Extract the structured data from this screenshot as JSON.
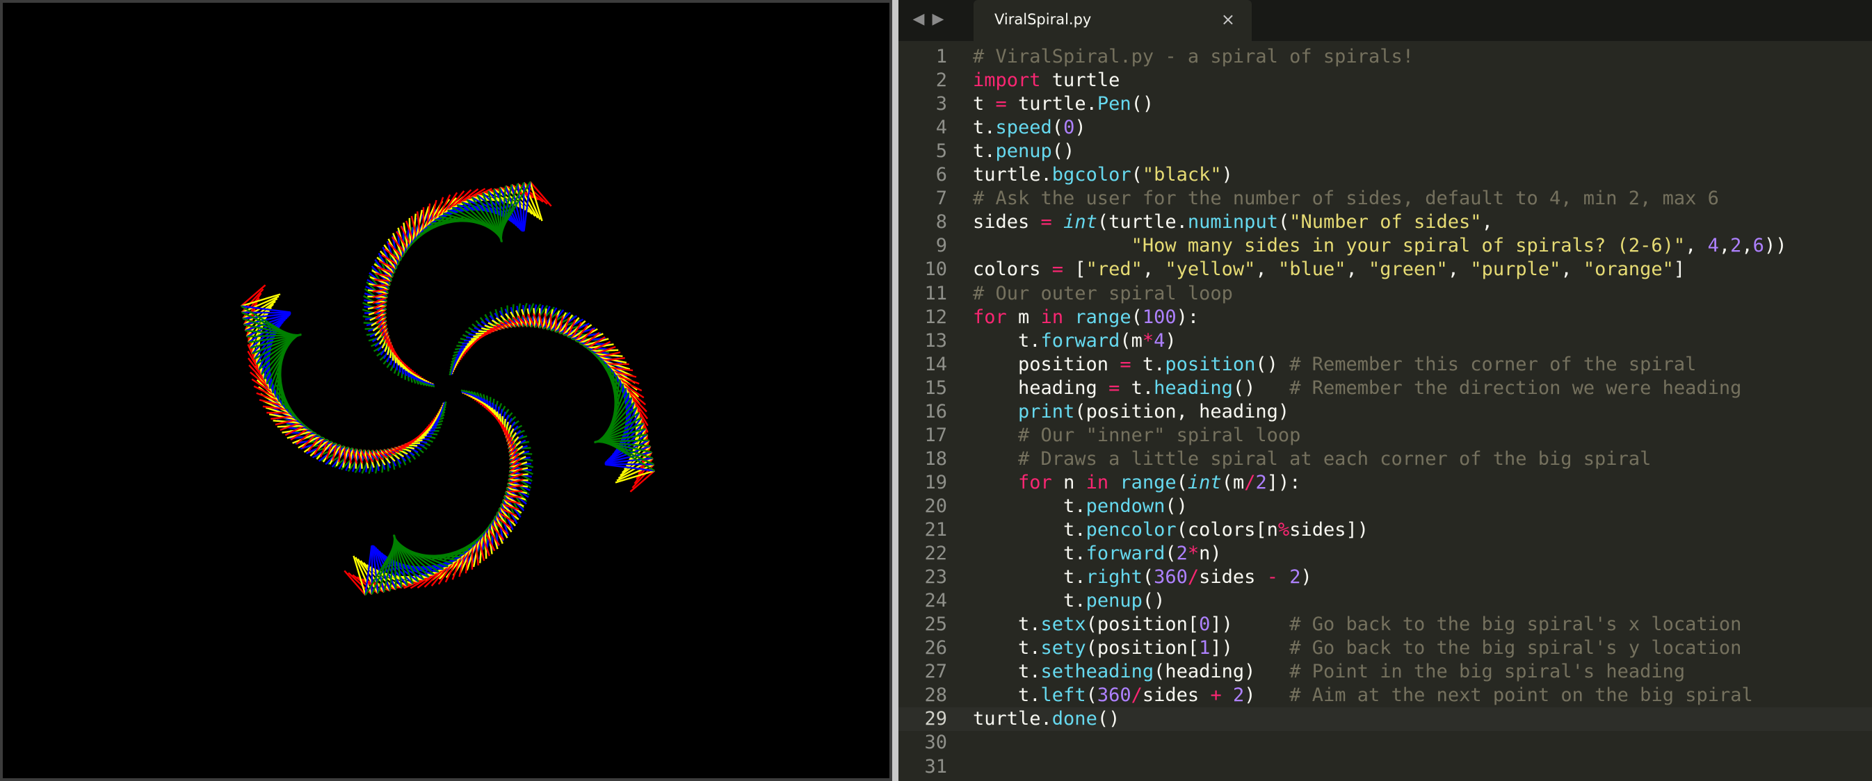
{
  "turtle_window": {
    "background": "#000000",
    "arm_colors": [
      "#ff0000",
      "#ffff00",
      "#0000ff",
      "#008000"
    ]
  },
  "editor": {
    "nav_back_icon": "chevron-left-icon",
    "nav_forward_icon": "chevron-right-icon",
    "back_glyph": "◀",
    "forward_glyph": "▶",
    "tab": {
      "title": "ViralSpiral.py",
      "close_glyph": "×",
      "close_icon": "close-icon"
    },
    "current_line": 29,
    "theme": {
      "background": "#272822",
      "comment": "#75715e",
      "keyword": "#f92672",
      "function": "#66d9ef",
      "string": "#e6db74",
      "number": "#ae81ff",
      "plain": "#f8f8f2"
    },
    "lines": [
      {
        "n": "1",
        "tokens": [
          [
            "comment",
            "# ViralSpiral.py - a spiral of spirals!"
          ]
        ]
      },
      {
        "n": "2",
        "tokens": [
          [
            "keyword",
            "import"
          ],
          [
            "plain",
            " turtle"
          ]
        ]
      },
      {
        "n": "3",
        "tokens": [
          [
            "plain",
            "t "
          ],
          [
            "operator",
            "="
          ],
          [
            "plain",
            " turtle."
          ],
          [
            "func",
            "Pen"
          ],
          [
            "plain",
            "()"
          ]
        ]
      },
      {
        "n": "4",
        "tokens": [
          [
            "plain",
            "t."
          ],
          [
            "func",
            "speed"
          ],
          [
            "plain",
            "("
          ],
          [
            "number",
            "0"
          ],
          [
            "plain",
            ")"
          ]
        ]
      },
      {
        "n": "5",
        "tokens": [
          [
            "plain",
            "t."
          ],
          [
            "func",
            "penup"
          ],
          [
            "plain",
            "()"
          ]
        ]
      },
      {
        "n": "6",
        "tokens": [
          [
            "plain",
            "turtle."
          ],
          [
            "func",
            "bgcolor"
          ],
          [
            "plain",
            "("
          ],
          [
            "string",
            "\"black\""
          ],
          [
            "plain",
            ")"
          ]
        ]
      },
      {
        "n": "7",
        "tokens": [
          [
            "comment",
            "# Ask the user for the number of sides, default to 4, min 2, max 6"
          ]
        ]
      },
      {
        "n": "8",
        "tokens": [
          [
            "plain",
            "sides "
          ],
          [
            "operator",
            "="
          ],
          [
            "plain",
            " "
          ],
          [
            "builtin",
            "int"
          ],
          [
            "plain",
            "(turtle."
          ],
          [
            "func",
            "numinput"
          ],
          [
            "plain",
            "("
          ],
          [
            "string",
            "\"Number of sides\""
          ],
          [
            "plain",
            ","
          ]
        ]
      },
      {
        "n": "9",
        "tokens": [
          [
            "plain",
            "              "
          ],
          [
            "string",
            "\"How many sides in your spiral of spirals? (2-6)\""
          ],
          [
            "plain",
            ", "
          ],
          [
            "number",
            "4"
          ],
          [
            "plain",
            ","
          ],
          [
            "number",
            "2"
          ],
          [
            "plain",
            ","
          ],
          [
            "number",
            "6"
          ],
          [
            "plain",
            "))"
          ]
        ]
      },
      {
        "n": "10",
        "tokens": [
          [
            "plain",
            "colors "
          ],
          [
            "operator",
            "="
          ],
          [
            "plain",
            " ["
          ],
          [
            "string",
            "\"red\""
          ],
          [
            "plain",
            ", "
          ],
          [
            "string",
            "\"yellow\""
          ],
          [
            "plain",
            ", "
          ],
          [
            "string",
            "\"blue\""
          ],
          [
            "plain",
            ", "
          ],
          [
            "string",
            "\"green\""
          ],
          [
            "plain",
            ", "
          ],
          [
            "string",
            "\"purple\""
          ],
          [
            "plain",
            ", "
          ],
          [
            "string",
            "\"orange\""
          ],
          [
            "plain",
            "]"
          ]
        ]
      },
      {
        "n": "11",
        "tokens": [
          [
            "comment",
            "# Our outer spiral loop"
          ]
        ]
      },
      {
        "n": "12",
        "tokens": [
          [
            "keyword",
            "for"
          ],
          [
            "plain",
            " m "
          ],
          [
            "keyword",
            "in"
          ],
          [
            "plain",
            " "
          ],
          [
            "func",
            "range"
          ],
          [
            "plain",
            "("
          ],
          [
            "number",
            "100"
          ],
          [
            "plain",
            "):"
          ]
        ]
      },
      {
        "n": "13",
        "tokens": [
          [
            "plain",
            "    t."
          ],
          [
            "func",
            "forward"
          ],
          [
            "plain",
            "(m"
          ],
          [
            "operator",
            "*"
          ],
          [
            "number",
            "4"
          ],
          [
            "plain",
            ")"
          ]
        ]
      },
      {
        "n": "14",
        "tokens": [
          [
            "plain",
            "    position "
          ],
          [
            "operator",
            "="
          ],
          [
            "plain",
            " t."
          ],
          [
            "func",
            "position"
          ],
          [
            "plain",
            "() "
          ],
          [
            "comment",
            "# Remember this corner of the spiral"
          ]
        ]
      },
      {
        "n": "15",
        "tokens": [
          [
            "plain",
            "    heading "
          ],
          [
            "operator",
            "="
          ],
          [
            "plain",
            " t."
          ],
          [
            "func",
            "heading"
          ],
          [
            "plain",
            "()   "
          ],
          [
            "comment",
            "# Remember the direction we were heading"
          ]
        ]
      },
      {
        "n": "16",
        "tokens": [
          [
            "plain",
            "    "
          ],
          [
            "func",
            "print"
          ],
          [
            "plain",
            "(position, heading)"
          ]
        ]
      },
      {
        "n": "17",
        "tokens": [
          [
            "plain",
            "    "
          ],
          [
            "comment",
            "# Our \"inner\" spiral loop"
          ]
        ]
      },
      {
        "n": "18",
        "tokens": [
          [
            "plain",
            "    "
          ],
          [
            "comment",
            "# Draws a little spiral at each corner of the big spiral"
          ]
        ]
      },
      {
        "n": "19",
        "tokens": [
          [
            "plain",
            "    "
          ],
          [
            "keyword",
            "for"
          ],
          [
            "plain",
            " n "
          ],
          [
            "keyword",
            "in"
          ],
          [
            "plain",
            " "
          ],
          [
            "func",
            "range"
          ],
          [
            "plain",
            "("
          ],
          [
            "builtin",
            "int"
          ],
          [
            "plain",
            "(m"
          ],
          [
            "operator",
            "/"
          ],
          [
            "number",
            "2"
          ],
          [
            "plain",
            "]):"
          ]
        ]
      },
      {
        "n": "20",
        "tokens": [
          [
            "plain",
            "        t."
          ],
          [
            "func",
            "pendown"
          ],
          [
            "plain",
            "()"
          ]
        ]
      },
      {
        "n": "21",
        "tokens": [
          [
            "plain",
            "        t."
          ],
          [
            "func",
            "pencolor"
          ],
          [
            "plain",
            "(colors[n"
          ],
          [
            "operator",
            "%"
          ],
          [
            "plain",
            "sides])"
          ]
        ]
      },
      {
        "n": "22",
        "tokens": [
          [
            "plain",
            "        t."
          ],
          [
            "func",
            "forward"
          ],
          [
            "plain",
            "("
          ],
          [
            "number",
            "2"
          ],
          [
            "operator",
            "*"
          ],
          [
            "plain",
            "n)"
          ]
        ]
      },
      {
        "n": "23",
        "tokens": [
          [
            "plain",
            "        t."
          ],
          [
            "func",
            "right"
          ],
          [
            "plain",
            "("
          ],
          [
            "number",
            "360"
          ],
          [
            "operator",
            "/"
          ],
          [
            "plain",
            "sides "
          ],
          [
            "operator",
            "-"
          ],
          [
            "plain",
            " "
          ],
          [
            "number",
            "2"
          ],
          [
            "plain",
            ")"
          ]
        ]
      },
      {
        "n": "24",
        "tokens": [
          [
            "plain",
            "        t."
          ],
          [
            "func",
            "penup"
          ],
          [
            "plain",
            "()"
          ]
        ]
      },
      {
        "n": "25",
        "tokens": [
          [
            "plain",
            "    t."
          ],
          [
            "func",
            "setx"
          ],
          [
            "plain",
            "(position["
          ],
          [
            "number",
            "0"
          ],
          [
            "plain",
            "])     "
          ],
          [
            "comment",
            "# Go back to the big spiral's x location"
          ]
        ]
      },
      {
        "n": "26",
        "tokens": [
          [
            "plain",
            "    t."
          ],
          [
            "func",
            "sety"
          ],
          [
            "plain",
            "(position["
          ],
          [
            "number",
            "1"
          ],
          [
            "plain",
            "])     "
          ],
          [
            "comment",
            "# Go back to the big spiral's y location"
          ]
        ]
      },
      {
        "n": "27",
        "tokens": [
          [
            "plain",
            "    t."
          ],
          [
            "func",
            "setheading"
          ],
          [
            "plain",
            "(heading)   "
          ],
          [
            "comment",
            "# Point in the big spiral's heading"
          ]
        ]
      },
      {
        "n": "28",
        "tokens": [
          [
            "plain",
            "    t."
          ],
          [
            "func",
            "left"
          ],
          [
            "plain",
            "("
          ],
          [
            "number",
            "360"
          ],
          [
            "operator",
            "/"
          ],
          [
            "plain",
            "sides "
          ],
          [
            "operator",
            "+"
          ],
          [
            "plain",
            " "
          ],
          [
            "number",
            "2"
          ],
          [
            "plain",
            ")   "
          ],
          [
            "comment",
            "# Aim at the next point on the big spiral"
          ]
        ]
      },
      {
        "n": "29",
        "tokens": [
          [
            "plain",
            "turtle."
          ],
          [
            "func",
            "done"
          ],
          [
            "plain",
            "()"
          ]
        ]
      },
      {
        "n": "30",
        "tokens": []
      },
      {
        "n": "31",
        "tokens": []
      }
    ]
  }
}
